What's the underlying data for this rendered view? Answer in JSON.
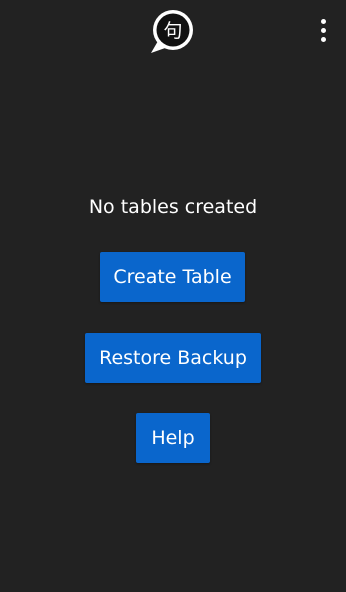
{
  "header": {
    "logo_glyph": "句",
    "logo_icon": "speech-bubble-logo-icon",
    "menu_icon": "more-vertical-icon"
  },
  "main": {
    "empty_message": "No tables created",
    "create_table_label": "Create Table",
    "restore_backup_label": "Restore Backup",
    "help_label": "Help"
  },
  "colors": {
    "background": "#222222",
    "button": "#0a66cc",
    "text": "#ffffff"
  }
}
